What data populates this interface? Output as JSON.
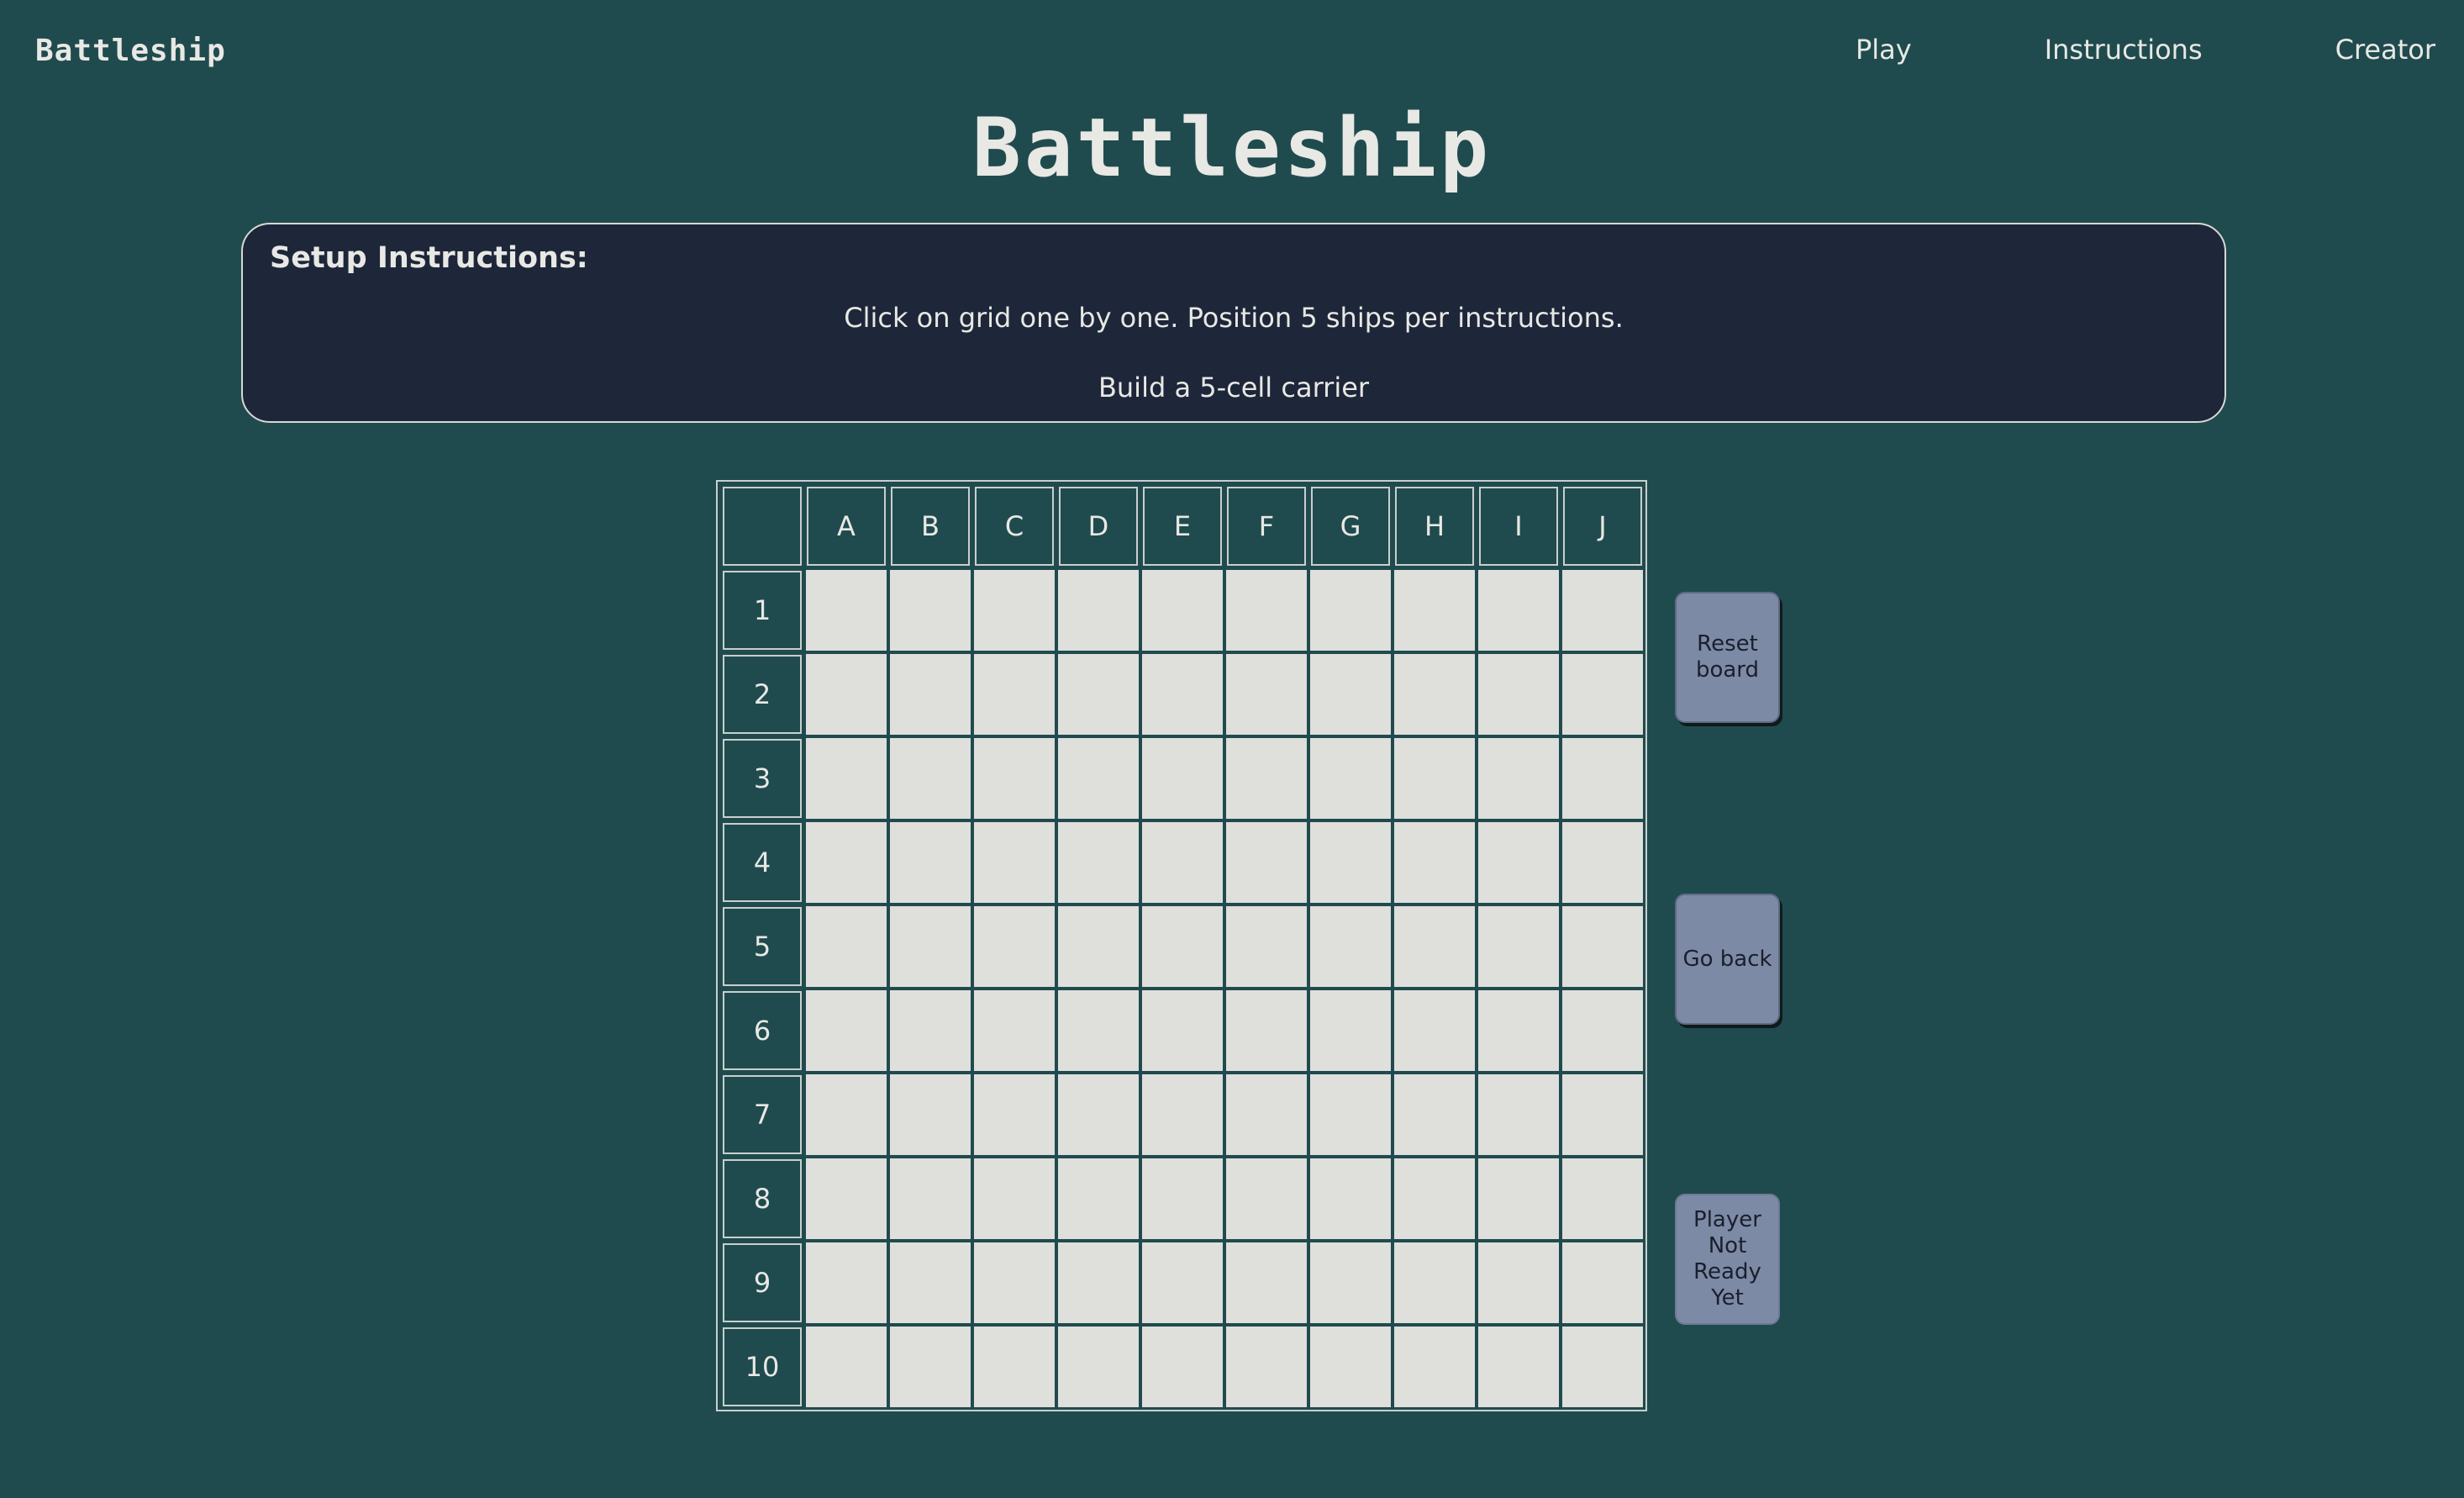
{
  "header": {
    "brand": "Battleship",
    "nav": [
      {
        "label": "Play"
      },
      {
        "label": "Instructions"
      },
      {
        "label": "Creator"
      }
    ]
  },
  "page_title": "Battleship",
  "instructions": {
    "heading": "Setup Instructions:",
    "line1": "Click on grid one by one. Position 5 ships per instructions.",
    "line2": "Build a 5-cell carrier"
  },
  "board": {
    "columns": [
      "A",
      "B",
      "C",
      "D",
      "E",
      "F",
      "G",
      "H",
      "I",
      "J"
    ],
    "rows": [
      "1",
      "2",
      "3",
      "4",
      "5",
      "6",
      "7",
      "8",
      "9",
      "10"
    ]
  },
  "buttons": {
    "reset": "Reset board",
    "go_back": "Go back",
    "ready": "Player Not Ready Yet"
  },
  "colors": {
    "background": "#204b4e",
    "panel": "#1e263a",
    "cell": "#dfdfdc",
    "button": "#7c8aa6"
  }
}
